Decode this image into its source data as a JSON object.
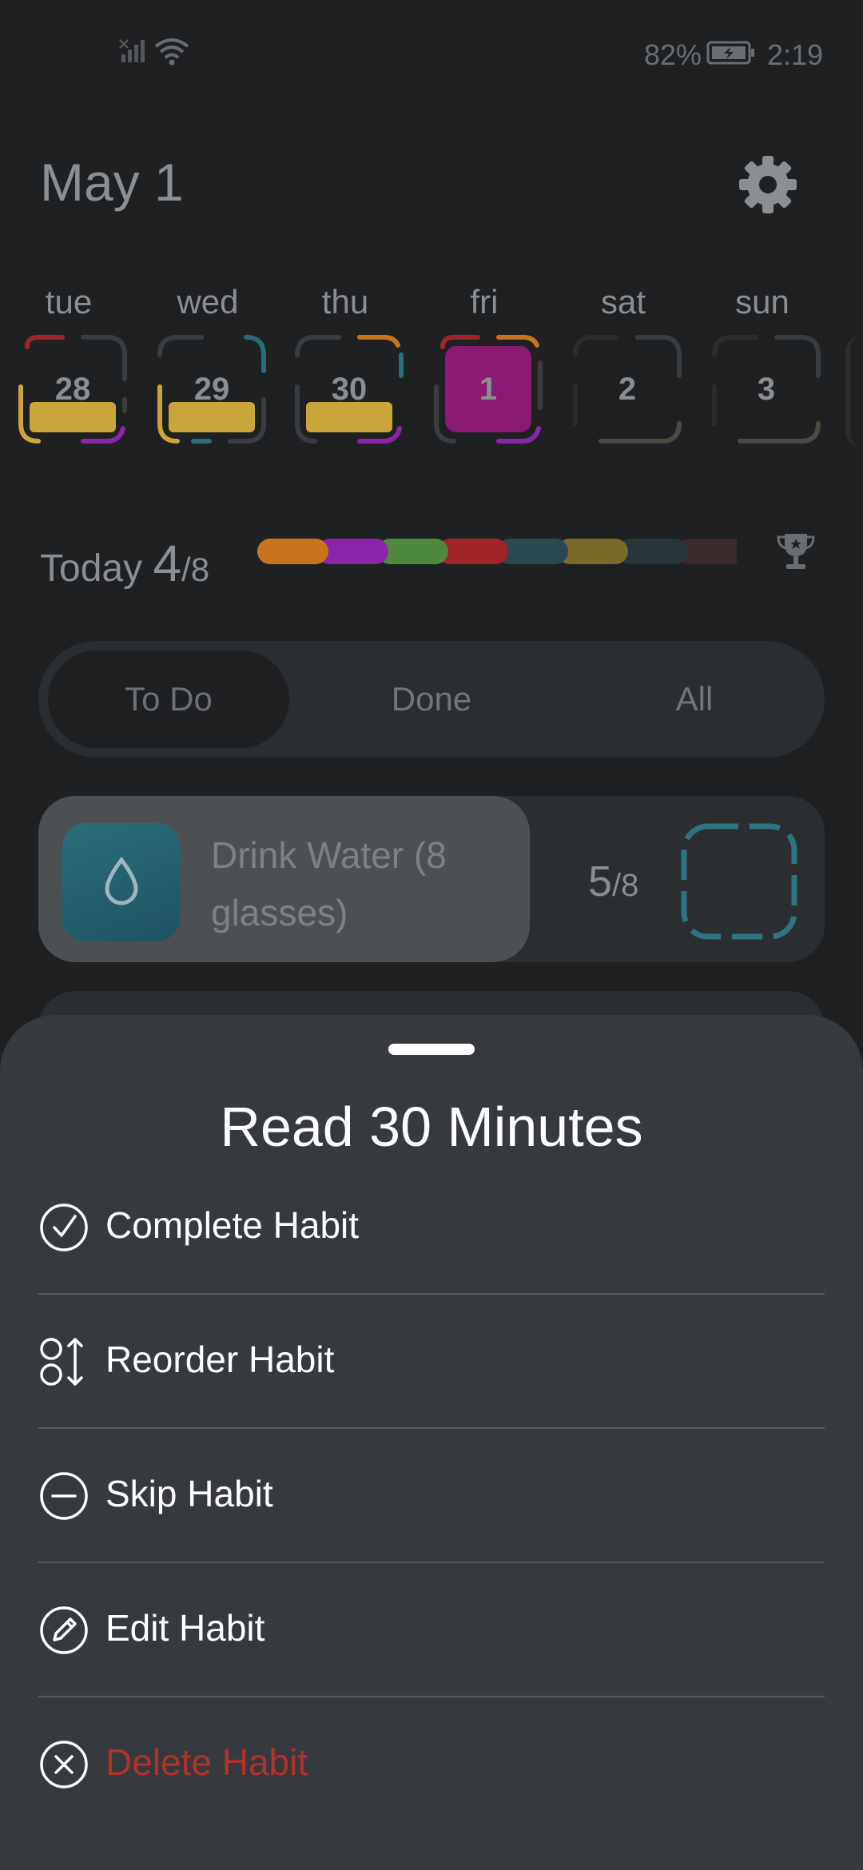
{
  "status_bar": {
    "battery_percent": "82%",
    "time": "2:19",
    "icons": [
      "no-signal-icon",
      "wifi-icon",
      "battery-charging-icon"
    ]
  },
  "header": {
    "date": "May 1",
    "settings_icon": "gear-icon"
  },
  "week": {
    "days": [
      {
        "label": "tue",
        "date": "28",
        "fill_fraction": 0.45
      },
      {
        "label": "wed",
        "date": "29",
        "fill_fraction": 0.45
      },
      {
        "label": "thu",
        "date": "30",
        "fill_fraction": 0.45
      },
      {
        "label": "fri",
        "date": "1",
        "selected": true
      },
      {
        "label": "sat",
        "date": "2",
        "fill_fraction": 0
      },
      {
        "label": "sun",
        "date": "3",
        "fill_fraction": 0
      }
    ]
  },
  "progress": {
    "label": "Today",
    "done": "4",
    "total": "/8",
    "segment_colors": [
      "#c9741c",
      "#8b24a8",
      "#4f8a3c",
      "#a0242a",
      "#2a4a52",
      "#7a6a2a",
      "#27363a",
      "#3a2a2c"
    ],
    "trophy_icon": "trophy-icon"
  },
  "tabs": {
    "items": [
      "To Do",
      "Done",
      "All"
    ],
    "active": "To Do"
  },
  "habit": {
    "name": "Drink Water (8 glasses)",
    "count": "5",
    "total": "/8",
    "progress_fraction": 0.625,
    "accent_color": "#2a6d79",
    "icon": "water-drop-icon"
  },
  "sheet": {
    "title": "Read 30 Minutes",
    "items": [
      {
        "label": "Complete Habit",
        "icon": "check-circle-icon"
      },
      {
        "label": "Reorder Habit",
        "icon": "reorder-icon"
      },
      {
        "label": "Skip Habit",
        "icon": "minus-circle-icon"
      },
      {
        "label": "Edit Habit",
        "icon": "pencil-circle-icon"
      },
      {
        "label": "Delete Habit",
        "icon": "x-circle-icon",
        "danger_color": "#b3322c"
      }
    ]
  }
}
